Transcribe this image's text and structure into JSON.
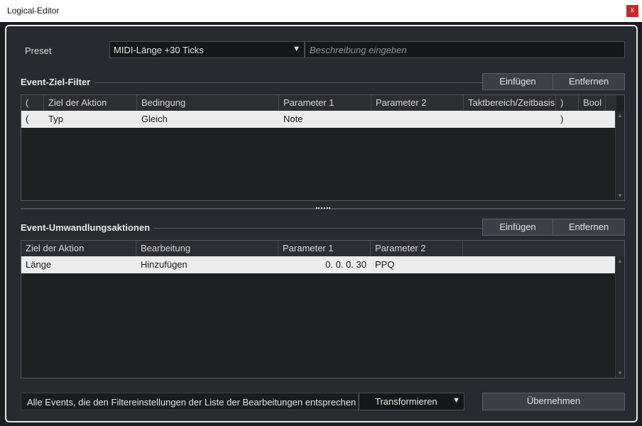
{
  "window": {
    "title": "Logical-Editor",
    "close_label": "x"
  },
  "preset": {
    "label": "Preset",
    "value": "MIDI-Länge +30 Ticks",
    "description_placeholder": "Beschreibung eingeben"
  },
  "filter": {
    "title": "Event-Ziel-Filter",
    "insert_label": "Einfügen",
    "remove_label": "Entfernen",
    "columns": [
      "(",
      "Ziel der Aktion",
      "Bedingung",
      "Parameter 1",
      "Parameter 2",
      "Taktbereich/Zeitbasis",
      ")",
      "Bool"
    ],
    "rows": [
      {
        "open": "(",
        "target": "Typ",
        "condition": "Gleich",
        "param1": "Note",
        "param2": "",
        "range": "",
        "close": ")",
        "bool": ""
      }
    ]
  },
  "actions": {
    "title": "Event-Umwandlungsaktionen",
    "insert_label": "Einfügen",
    "remove_label": "Entfernen",
    "columns": [
      "Ziel der Aktion",
      "Bearbeitung",
      "Parameter 1",
      "Parameter 2"
    ],
    "rows": [
      {
        "target": "Länge",
        "operation": "Hinzufügen",
        "param1": "0. 0. 0. 30",
        "param2": "PPQ"
      }
    ]
  },
  "footer": {
    "info_text": "Alle Events, die den Filtereinstellungen der Liste der Bearbeitungen entsprechen",
    "function_value": "Transformieren",
    "apply_label": "Übernehmen"
  }
}
